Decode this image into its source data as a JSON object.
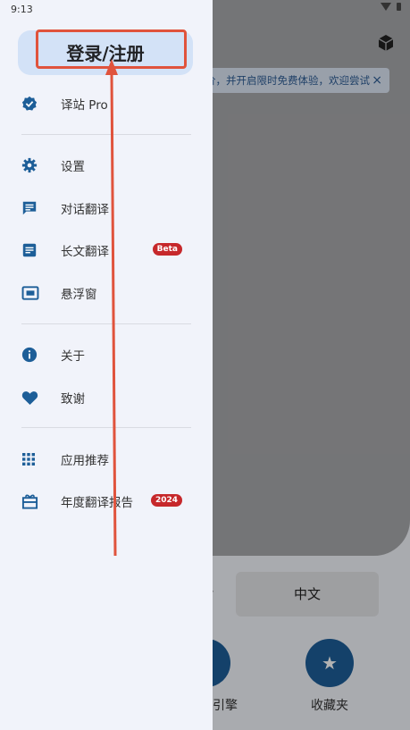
{
  "status_bar": {
    "time": "9:13"
  },
  "background": {
    "notice_text": "价，并开启限时免费体验，欢迎尝试",
    "notice_close": "×",
    "language_label": "中文",
    "left_button_label_fragment": "引擎",
    "favorites_label": "收藏夹",
    "favorites_icon": "★",
    "accent_color": "#1d5e98"
  },
  "drawer": {
    "login_label": "登录/注册",
    "items": [
      {
        "label": "译站 Pro",
        "icon": "verified-badge-icon"
      },
      {
        "label": "设置",
        "icon": "gear-icon"
      },
      {
        "label": "对话翻译",
        "icon": "chat-icon"
      },
      {
        "label": "长文翻译",
        "icon": "document-icon",
        "badge": "Beta"
      },
      {
        "label": "悬浮窗",
        "icon": "picture-in-picture-icon"
      },
      {
        "label": "关于",
        "icon": "info-icon"
      },
      {
        "label": "致谢",
        "icon": "heart-icon"
      },
      {
        "label": "应用推荐",
        "icon": "apps-grid-icon"
      },
      {
        "label": "年度翻译报告",
        "icon": "gift-icon",
        "badge": "2024"
      }
    ],
    "icon_color": "#1d5e98",
    "badge_color": "#c6282b"
  },
  "annotation": {
    "color": "#e0533c"
  }
}
